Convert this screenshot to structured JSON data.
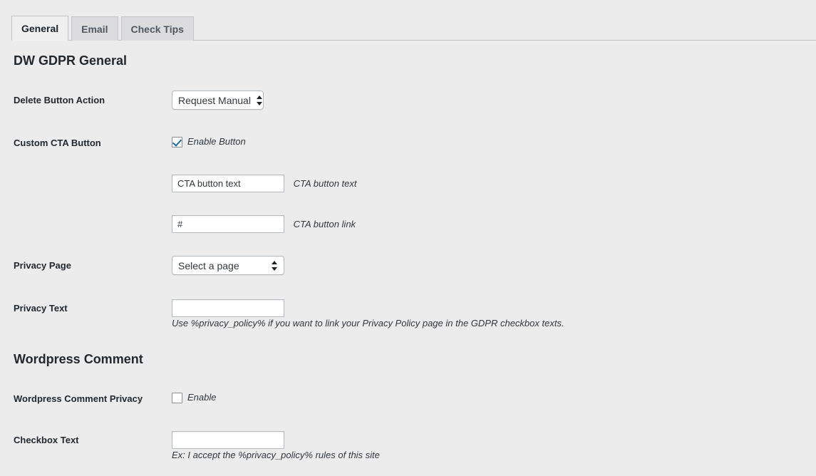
{
  "tabs": [
    {
      "label": "General",
      "active": true
    },
    {
      "label": "Email",
      "active": false
    },
    {
      "label": "Check Tips",
      "active": false
    }
  ],
  "sections": {
    "general": {
      "heading": "DW GDPR General",
      "delete_button_action": {
        "label": "Delete Button Action",
        "selected": "Request Manual"
      },
      "custom_cta_button": {
        "label": "Custom CTA Button",
        "enable_label": "Enable Button",
        "enabled": true,
        "text_value": "CTA button text",
        "text_desc": "CTA button text",
        "link_value": "#",
        "link_desc": "CTA button link"
      },
      "privacy_page": {
        "label": "Privacy Page",
        "selected": "Select a page"
      },
      "privacy_text": {
        "label": "Privacy Text",
        "value": "",
        "help": "Use %privacy_policy% if you want to link your Privacy Policy page in the GDPR checkbox texts."
      }
    },
    "wordpress_comment": {
      "heading": "Wordpress Comment",
      "comment_privacy": {
        "label": "Wordpress Comment Privacy",
        "enable_label": "Enable",
        "enabled": false
      },
      "checkbox_text": {
        "label": "Checkbox Text",
        "value": "",
        "help": "Ex: I accept the %privacy_policy% rules of this site"
      }
    }
  }
}
